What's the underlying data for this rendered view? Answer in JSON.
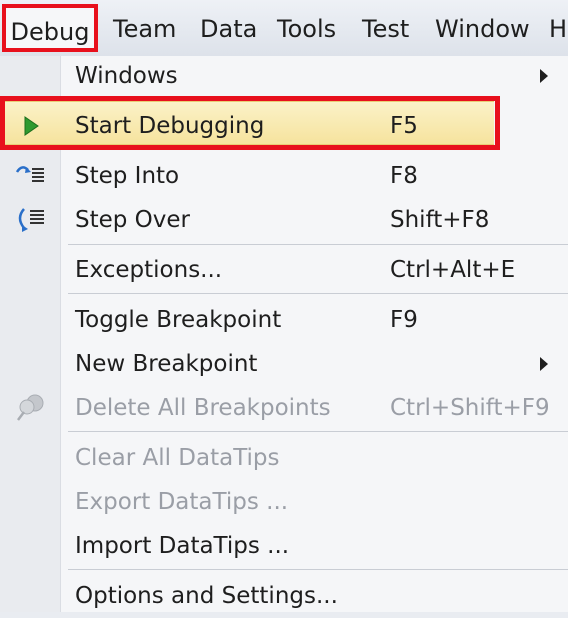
{
  "menubar": {
    "debug": "Debug",
    "team": "Team",
    "data": "Data",
    "tools": "Tools",
    "test": "Test",
    "window": "Window",
    "help": "H"
  },
  "menu": {
    "windows": {
      "label": "Windows"
    },
    "start_debugging": {
      "label": "Start Debugging",
      "shortcut": "F5",
      "icon": "play-icon"
    },
    "step_into": {
      "label": "Step Into",
      "shortcut": "F8",
      "icon": "step-into-icon"
    },
    "step_over": {
      "label": "Step Over",
      "shortcut": "Shift+F8",
      "icon": "step-over-icon"
    },
    "exceptions": {
      "label": "Exceptions...",
      "shortcut": "Ctrl+Alt+E"
    },
    "toggle_breakpoint": {
      "label": "Toggle Breakpoint",
      "shortcut": "F9"
    },
    "new_breakpoint": {
      "label": "New Breakpoint"
    },
    "delete_all_breakpoints": {
      "label": "Delete All Breakpoints",
      "shortcut": "Ctrl+Shift+F9",
      "icon": "breakpoints-icon"
    },
    "clear_all_datatips": {
      "label": "Clear All DataTips"
    },
    "export_datatips": {
      "label": "Export DataTips ..."
    },
    "import_datatips": {
      "label": "Import DataTips ..."
    },
    "options_settings": {
      "label": "Options and Settings..."
    }
  },
  "colors": {
    "highlight_border": "#e8101c",
    "hover_fill": "#f6e39e",
    "disabled_text": "#9a9ea6"
  }
}
